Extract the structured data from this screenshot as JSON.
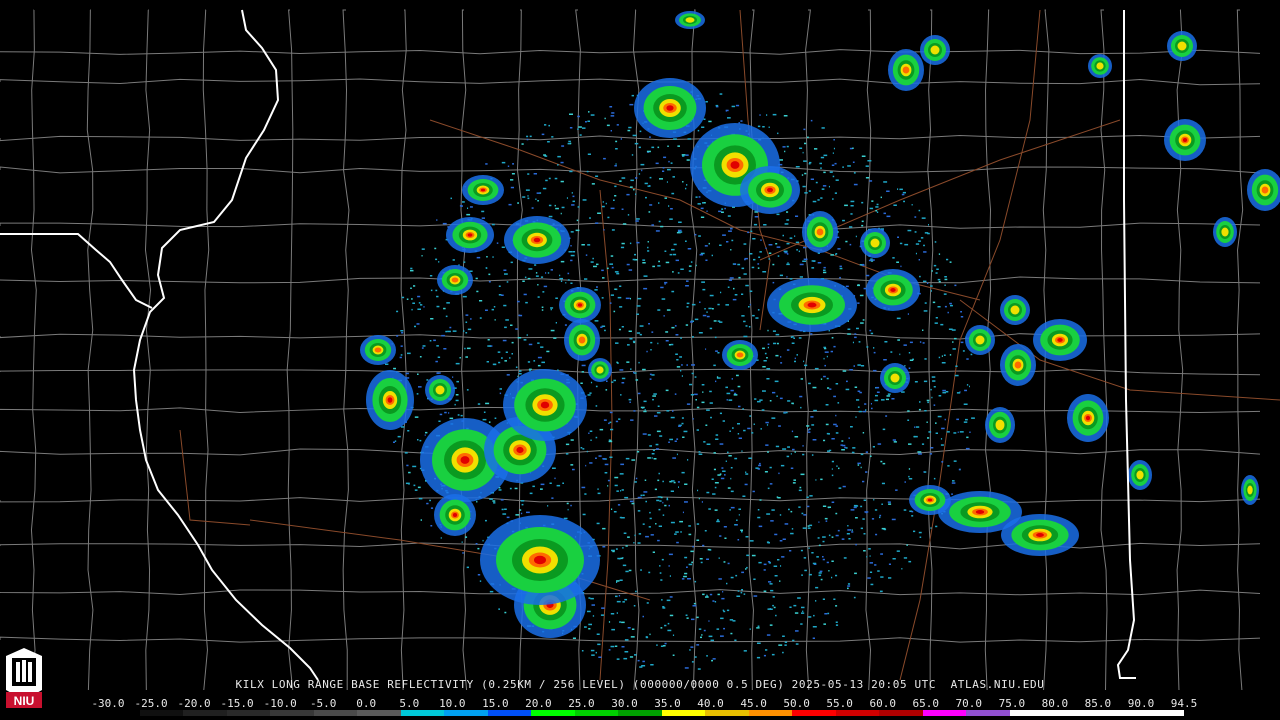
{
  "radar": {
    "caption": "KILX LONG RANGE BASE REFLECTIVITY (0.25KM / 256 LEVEL) (000000/0000 0.5 DEG) 2025-05-13 20:05 UTC  ATLAS.NIU.EDU",
    "logo_text": "NIU"
  },
  "scale": {
    "labels": [
      "-30.0",
      "-25.0",
      "-20.0",
      "-15.0",
      "-10.0",
      "-5.0",
      "0.0",
      "5.0",
      "10.0",
      "15.0",
      "20.0",
      "25.0",
      "30.0",
      "35.0",
      "40.0",
      "45.0",
      "50.0",
      "55.0",
      "60.0",
      "65.0",
      "70.0",
      "75.0",
      "80.0",
      "85.0",
      "90.0",
      "94.5"
    ],
    "colors": [
      "#000000",
      "#101010",
      "#202020",
      "#2a2a2a",
      "#383838",
      "#4a4a4a",
      "#5a5a5a",
      "#00c8d8",
      "#00a0f0",
      "#0050f8",
      "#00ff00",
      "#00d000",
      "#00a000",
      "#ffff00",
      "#e8c000",
      "#ff9000",
      "#ff0000",
      "#d00000",
      "#b00000",
      "#ff00ff",
      "#9050d0",
      "#ffffff",
      "#ffffff",
      "#ffffff",
      "#ffffff"
    ]
  },
  "map_style": {
    "state_border": "#ffffff",
    "county_line": "#7a7a7a",
    "road_line": "#8a4a2a",
    "background": "#000000"
  }
}
